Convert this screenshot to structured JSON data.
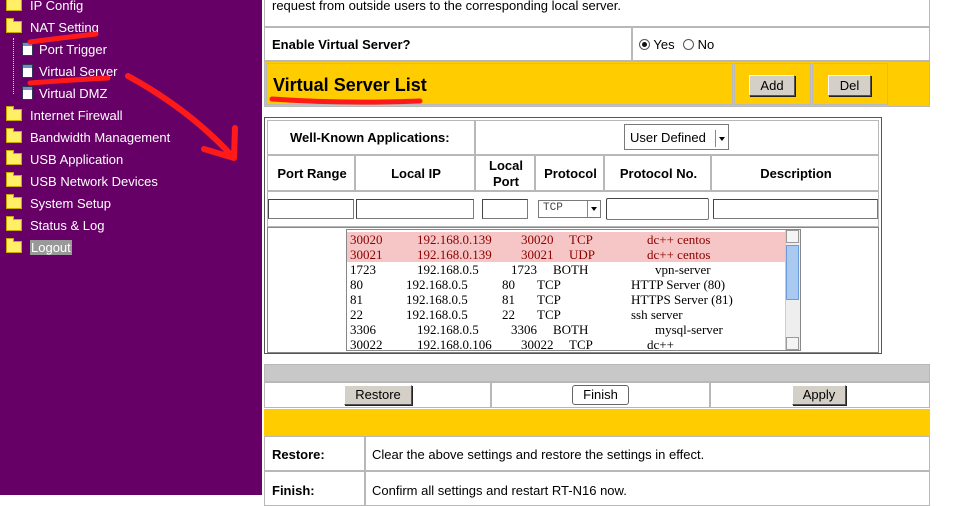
{
  "sidebar": {
    "items": [
      {
        "label": "IP Config"
      },
      {
        "label": "NAT Setting"
      },
      {
        "label": "Port Trigger"
      },
      {
        "label": "Virtual Server"
      },
      {
        "label": "Virtual DMZ"
      },
      {
        "label": "Internet Firewall"
      },
      {
        "label": "Bandwidth Management"
      },
      {
        "label": "USB Application"
      },
      {
        "label": "USB Network Devices"
      },
      {
        "label": "System Setup"
      },
      {
        "label": "Status & Log"
      },
      {
        "label": "Logout"
      }
    ]
  },
  "intro_text": "request from outside users to the corresponding local server.",
  "enable": {
    "label": "Enable Virtual Server?",
    "yes": "Yes",
    "no": "No",
    "selected": "Yes"
  },
  "list_header": {
    "title": "Virtual Server List",
    "add": "Add",
    "del": "Del"
  },
  "apps": {
    "label": "Well-Known Applications:",
    "selected": "User Defined"
  },
  "columns": {
    "port_range": "Port Range",
    "local_ip": "Local IP",
    "local_port": "Local Port",
    "protocol": "Protocol",
    "protocol_no": "Protocol No.",
    "description": "Description"
  },
  "protocol_select": "TCP",
  "rules": [
    {
      "range": "30020",
      "ip": "192.168.0.139",
      "port": "30020",
      "proto": "TCP",
      "desc": "dc++ centos",
      "selected": true
    },
    {
      "range": "30021",
      "ip": "192.168.0.139",
      "port": "30021",
      "proto": "UDP",
      "desc": "dc++ centos",
      "selected": true
    },
    {
      "range": "1723",
      "ip": "192.168.0.5",
      "port": "1723",
      "proto": "BOTH",
      "desc": "vpn-server",
      "selected": false
    },
    {
      "range": "80",
      "ip": "192.168.0.5",
      "port": "80",
      "proto": "TCP",
      "desc": "HTTP Server (80)",
      "selected": false
    },
    {
      "range": "81",
      "ip": "192.168.0.5",
      "port": "81",
      "proto": "TCP",
      "desc": "HTTPS Server (81)",
      "selected": false
    },
    {
      "range": "22",
      "ip": "192.168.0.5",
      "port": "22",
      "proto": "TCP",
      "desc": "ssh server",
      "selected": false
    },
    {
      "range": "3306",
      "ip": "192.168.0.5",
      "port": "3306",
      "proto": "BOTH",
      "desc": "mysql-server",
      "selected": false
    },
    {
      "range": "30022",
      "ip": "192.168.0.106",
      "port": "30022",
      "proto": "TCP",
      "desc": "dc++",
      "selected": false
    }
  ],
  "actions": {
    "restore": "Restore",
    "finish": "Finish",
    "apply": "Apply"
  },
  "help": [
    {
      "term": "Restore:",
      "text": "Clear the above settings and restore the settings in effect."
    },
    {
      "term": "Finish:",
      "text": "Confirm all settings and restart RT-N16 now."
    }
  ],
  "colors": {
    "sidebar": "#660066",
    "header": "#ffcc00",
    "annotation": "#ff1a1a"
  }
}
